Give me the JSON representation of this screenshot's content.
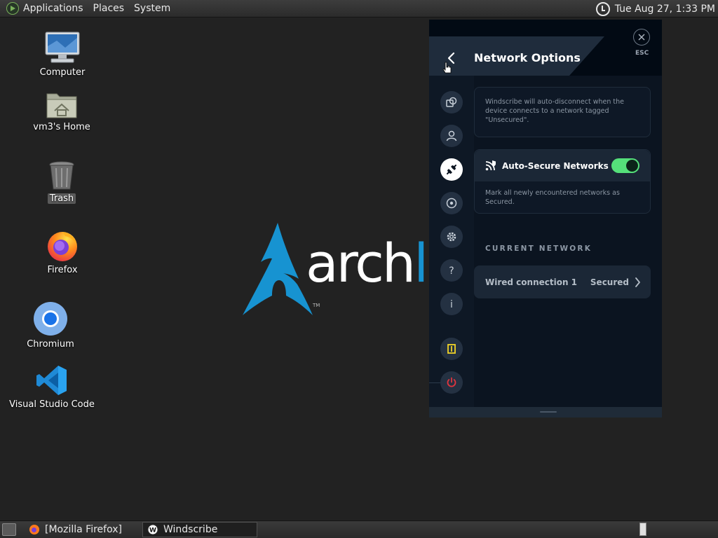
{
  "top_panel": {
    "menus": [
      "Applications",
      "Places",
      "System"
    ],
    "clock": "Tue Aug 27,  1:33 PM"
  },
  "desktop": {
    "icons": [
      {
        "label": "Computer",
        "icon": "computer-icon"
      },
      {
        "label": "vm3's Home",
        "icon": "home-folder-icon"
      },
      {
        "label": "Trash",
        "icon": "trash-icon"
      },
      {
        "label": "Firefox",
        "icon": "firefox-icon"
      },
      {
        "label": "Chromium",
        "icon": "chromium-icon"
      },
      {
        "label": "Visual Studio Code",
        "icon": "vscode-icon"
      }
    ],
    "wallpaper": {
      "word1": "arch",
      "word2": "lin",
      "tm": "TM"
    }
  },
  "windscribe": {
    "title": "Network Options",
    "esc_label": "ESC",
    "info_text": "Windscribe will auto-disconnect when the device connects to a network tagged \"Unsecured\".",
    "auto_secure": {
      "label": "Auto-Secure Networks",
      "enabled": true,
      "description": "Mark all newly encountered networks as Secured."
    },
    "current_network_title": "CURRENT NETWORK",
    "current_network": {
      "name": "Wired connection 1",
      "status": "Secured"
    },
    "sidebar_icons": [
      "connection-icon",
      "account-icon",
      "network-options-icon",
      "robert-icon",
      "preferences-icon",
      "help-icon",
      "about-icon",
      "notifications-icon",
      "power-icon"
    ],
    "colors": {
      "accent_green": "#55e07a",
      "notification_yellow": "#f2d528",
      "power_red": "#e0353e"
    }
  },
  "taskbar": {
    "tasks": [
      {
        "label": "[Mozilla Firefox]",
        "active": false
      },
      {
        "label": "Windscribe",
        "active": true
      }
    ]
  }
}
